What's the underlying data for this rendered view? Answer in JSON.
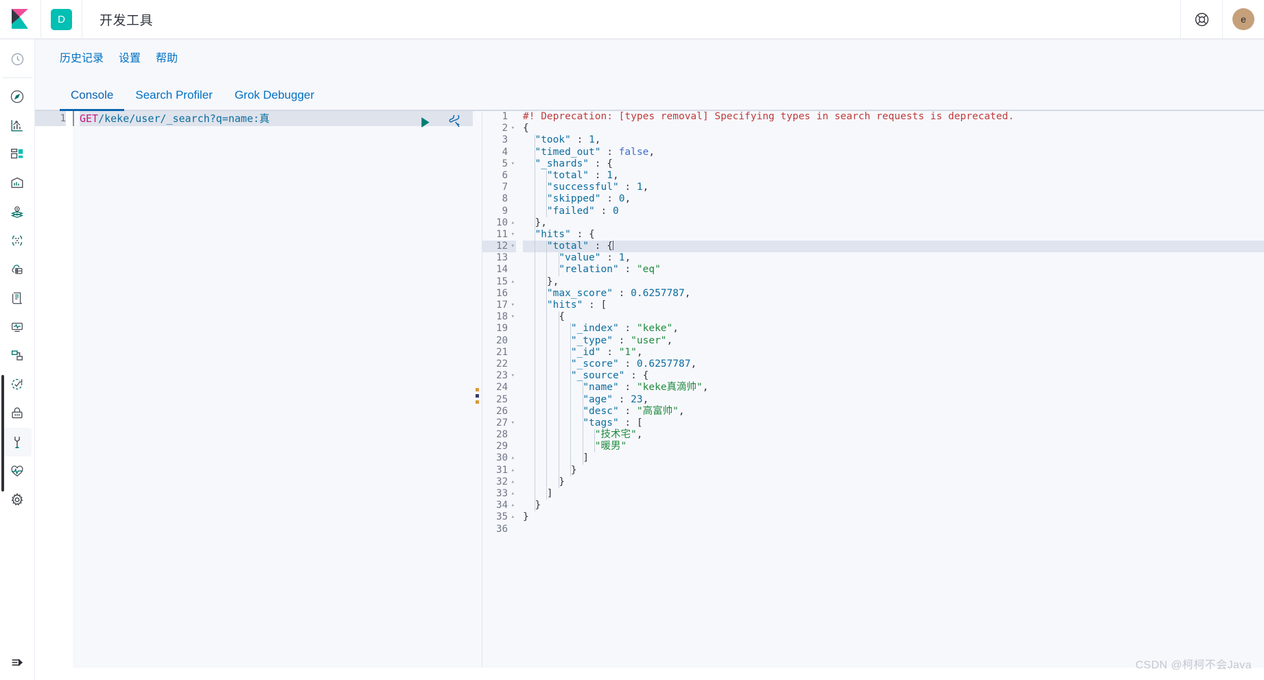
{
  "header": {
    "app_badge": "D",
    "title": "开发工具",
    "help_icon": "lifebuoy-icon",
    "avatar_initial": "e"
  },
  "sidebar": {
    "items": [
      {
        "icon": "clock-icon",
        "name": "recently-viewed"
      },
      {
        "icon": "compass-icon",
        "name": "discover"
      },
      {
        "icon": "bar-chart-icon",
        "name": "visualize"
      },
      {
        "icon": "dashboard-icon",
        "name": "dashboard"
      },
      {
        "icon": "canvas-icon",
        "name": "canvas"
      },
      {
        "icon": "map-pin-layers-icon",
        "name": "maps"
      },
      {
        "icon": "machine-learning-icon",
        "name": "machine-learning"
      },
      {
        "icon": "infrastructure-icon",
        "name": "infrastructure"
      },
      {
        "icon": "logs-icon",
        "name": "logs"
      },
      {
        "icon": "apm-icon",
        "name": "apm"
      },
      {
        "icon": "uptime-icon",
        "name": "uptime"
      },
      {
        "icon": "siem-icon",
        "name": "siem"
      },
      {
        "icon": "lock-icon",
        "name": "security"
      },
      {
        "icon": "wrench-icon",
        "name": "dev-tools",
        "selected": true
      },
      {
        "icon": "heartbeat-icon",
        "name": "monitoring"
      },
      {
        "icon": "gear-icon",
        "name": "management"
      }
    ],
    "collapse_icon": "collapse-arrow-icon"
  },
  "topnav": {
    "links": [
      {
        "label": "历史记录"
      },
      {
        "label": "设置"
      },
      {
        "label": "帮助"
      }
    ]
  },
  "tabs": [
    {
      "label": "Console",
      "active": true
    },
    {
      "label": "Search Profiler",
      "active": false
    },
    {
      "label": "Grok Debugger",
      "active": false
    }
  ],
  "editor": {
    "line_number": "1",
    "method": "GET",
    "path": "/keke/user/_search?q=name:真",
    "run_icon": "play-icon",
    "wrench_icon": "wrench-icon"
  },
  "splitter": {
    "name": "pane-splitter",
    "grip_icon": "drag-handle-icon"
  },
  "response": {
    "lines": [
      {
        "n": "1",
        "fold": "",
        "indent": 0,
        "tokens": [
          {
            "t": "#! Deprecation: [types removal] Specifying types in search requests is deprecated.",
            "c": "tok-warn"
          }
        ]
      },
      {
        "n": "2",
        "fold": "▾",
        "indent": 0,
        "tokens": [
          {
            "t": "{",
            "c": "tok-pun"
          }
        ]
      },
      {
        "n": "3",
        "fold": "",
        "indent": 1,
        "tokens": [
          {
            "t": "\"took\"",
            "c": "tok-key"
          },
          {
            "t": " : ",
            "c": "tok-pun"
          },
          {
            "t": "1",
            "c": "tok-num"
          },
          {
            "t": ",",
            "c": "tok-pun"
          }
        ]
      },
      {
        "n": "4",
        "fold": "",
        "indent": 1,
        "tokens": [
          {
            "t": "\"timed_out\"",
            "c": "tok-key"
          },
          {
            "t": " : ",
            "c": "tok-pun"
          },
          {
            "t": "false",
            "c": "tok-bool"
          },
          {
            "t": ",",
            "c": "tok-pun"
          }
        ]
      },
      {
        "n": "5",
        "fold": "▾",
        "indent": 1,
        "tokens": [
          {
            "t": "\"_shards\"",
            "c": "tok-key"
          },
          {
            "t": " : {",
            "c": "tok-pun"
          }
        ]
      },
      {
        "n": "6",
        "fold": "",
        "indent": 2,
        "tokens": [
          {
            "t": "\"total\"",
            "c": "tok-key"
          },
          {
            "t": " : ",
            "c": "tok-pun"
          },
          {
            "t": "1",
            "c": "tok-num"
          },
          {
            "t": ",",
            "c": "tok-pun"
          }
        ]
      },
      {
        "n": "7",
        "fold": "",
        "indent": 2,
        "tokens": [
          {
            "t": "\"successful\"",
            "c": "tok-key"
          },
          {
            "t": " : ",
            "c": "tok-pun"
          },
          {
            "t": "1",
            "c": "tok-num"
          },
          {
            "t": ",",
            "c": "tok-pun"
          }
        ]
      },
      {
        "n": "8",
        "fold": "",
        "indent": 2,
        "tokens": [
          {
            "t": "\"skipped\"",
            "c": "tok-key"
          },
          {
            "t": " : ",
            "c": "tok-pun"
          },
          {
            "t": "0",
            "c": "tok-num"
          },
          {
            "t": ",",
            "c": "tok-pun"
          }
        ]
      },
      {
        "n": "9",
        "fold": "",
        "indent": 2,
        "tokens": [
          {
            "t": "\"failed\"",
            "c": "tok-key"
          },
          {
            "t": " : ",
            "c": "tok-pun"
          },
          {
            "t": "0",
            "c": "tok-num"
          }
        ]
      },
      {
        "n": "10",
        "fold": "▴",
        "indent": 1,
        "tokens": [
          {
            "t": "},",
            "c": "tok-pun"
          }
        ]
      },
      {
        "n": "11",
        "fold": "▾",
        "indent": 1,
        "tokens": [
          {
            "t": "\"hits\"",
            "c": "tok-key"
          },
          {
            "t": " : {",
            "c": "tok-pun"
          }
        ]
      },
      {
        "n": "12",
        "fold": "▾",
        "indent": 2,
        "highlight": true,
        "caret": true,
        "tokens": [
          {
            "t": "\"total\"",
            "c": "tok-key"
          },
          {
            "t": " : {",
            "c": "tok-pun"
          }
        ]
      },
      {
        "n": "13",
        "fold": "",
        "indent": 3,
        "tokens": [
          {
            "t": "\"value\"",
            "c": "tok-key"
          },
          {
            "t": " : ",
            "c": "tok-pun"
          },
          {
            "t": "1",
            "c": "tok-num"
          },
          {
            "t": ",",
            "c": "tok-pun"
          }
        ]
      },
      {
        "n": "14",
        "fold": "",
        "indent": 3,
        "tokens": [
          {
            "t": "\"relation\"",
            "c": "tok-key"
          },
          {
            "t": " : ",
            "c": "tok-pun"
          },
          {
            "t": "\"eq\"",
            "c": "tok-str"
          }
        ]
      },
      {
        "n": "15",
        "fold": "▴",
        "indent": 2,
        "tokens": [
          {
            "t": "},",
            "c": "tok-pun"
          }
        ]
      },
      {
        "n": "16",
        "fold": "",
        "indent": 2,
        "tokens": [
          {
            "t": "\"max_score\"",
            "c": "tok-key"
          },
          {
            "t": " : ",
            "c": "tok-pun"
          },
          {
            "t": "0.6257787",
            "c": "tok-num"
          },
          {
            "t": ",",
            "c": "tok-pun"
          }
        ]
      },
      {
        "n": "17",
        "fold": "▾",
        "indent": 2,
        "tokens": [
          {
            "t": "\"hits\"",
            "c": "tok-key"
          },
          {
            "t": " : [",
            "c": "tok-pun"
          }
        ]
      },
      {
        "n": "18",
        "fold": "▾",
        "indent": 3,
        "tokens": [
          {
            "t": "{",
            "c": "tok-pun"
          }
        ]
      },
      {
        "n": "19",
        "fold": "",
        "indent": 4,
        "tokens": [
          {
            "t": "\"_index\"",
            "c": "tok-key"
          },
          {
            "t": " : ",
            "c": "tok-pun"
          },
          {
            "t": "\"keke\"",
            "c": "tok-str"
          },
          {
            "t": ",",
            "c": "tok-pun"
          }
        ]
      },
      {
        "n": "20",
        "fold": "",
        "indent": 4,
        "tokens": [
          {
            "t": "\"_type\"",
            "c": "tok-key"
          },
          {
            "t": " : ",
            "c": "tok-pun"
          },
          {
            "t": "\"user\"",
            "c": "tok-str"
          },
          {
            "t": ",",
            "c": "tok-pun"
          }
        ]
      },
      {
        "n": "21",
        "fold": "",
        "indent": 4,
        "tokens": [
          {
            "t": "\"_id\"",
            "c": "tok-key"
          },
          {
            "t": " : ",
            "c": "tok-pun"
          },
          {
            "t": "\"1\"",
            "c": "tok-str"
          },
          {
            "t": ",",
            "c": "tok-pun"
          }
        ]
      },
      {
        "n": "22",
        "fold": "",
        "indent": 4,
        "tokens": [
          {
            "t": "\"_score\"",
            "c": "tok-key"
          },
          {
            "t": " : ",
            "c": "tok-pun"
          },
          {
            "t": "0.6257787",
            "c": "tok-num"
          },
          {
            "t": ",",
            "c": "tok-pun"
          }
        ]
      },
      {
        "n": "23",
        "fold": "▾",
        "indent": 4,
        "tokens": [
          {
            "t": "\"_source\"",
            "c": "tok-key"
          },
          {
            "t": " : {",
            "c": "tok-pun"
          }
        ]
      },
      {
        "n": "24",
        "fold": "",
        "indent": 5,
        "tokens": [
          {
            "t": "\"name\"",
            "c": "tok-key"
          },
          {
            "t": " : ",
            "c": "tok-pun"
          },
          {
            "t": "\"keke真滴帅\"",
            "c": "tok-str"
          },
          {
            "t": ",",
            "c": "tok-pun"
          }
        ]
      },
      {
        "n": "25",
        "fold": "",
        "indent": 5,
        "tokens": [
          {
            "t": "\"age\"",
            "c": "tok-key"
          },
          {
            "t": " : ",
            "c": "tok-pun"
          },
          {
            "t": "23",
            "c": "tok-num"
          },
          {
            "t": ",",
            "c": "tok-pun"
          }
        ]
      },
      {
        "n": "26",
        "fold": "",
        "indent": 5,
        "tokens": [
          {
            "t": "\"desc\"",
            "c": "tok-key"
          },
          {
            "t": " : ",
            "c": "tok-pun"
          },
          {
            "t": "\"高富帅\"",
            "c": "tok-str"
          },
          {
            "t": ",",
            "c": "tok-pun"
          }
        ]
      },
      {
        "n": "27",
        "fold": "▾",
        "indent": 5,
        "tokens": [
          {
            "t": "\"tags\"",
            "c": "tok-key"
          },
          {
            "t": " : [",
            "c": "tok-pun"
          }
        ]
      },
      {
        "n": "28",
        "fold": "",
        "indent": 6,
        "tokens": [
          {
            "t": "\"技术宅\"",
            "c": "tok-str"
          },
          {
            "t": ",",
            "c": "tok-pun"
          }
        ]
      },
      {
        "n": "29",
        "fold": "",
        "indent": 6,
        "tokens": [
          {
            "t": "\"暖男\"",
            "c": "tok-str"
          }
        ]
      },
      {
        "n": "30",
        "fold": "▴",
        "indent": 5,
        "tokens": [
          {
            "t": "]",
            "c": "tok-pun"
          }
        ]
      },
      {
        "n": "31",
        "fold": "▴",
        "indent": 4,
        "tokens": [
          {
            "t": "}",
            "c": "tok-pun"
          }
        ]
      },
      {
        "n": "32",
        "fold": "▴",
        "indent": 3,
        "tokens": [
          {
            "t": "}",
            "c": "tok-pun"
          }
        ]
      },
      {
        "n": "33",
        "fold": "▴",
        "indent": 2,
        "tokens": [
          {
            "t": "]",
            "c": "tok-pun"
          }
        ]
      },
      {
        "n": "34",
        "fold": "▴",
        "indent": 1,
        "tokens": [
          {
            "t": "}",
            "c": "tok-pun"
          }
        ]
      },
      {
        "n": "35",
        "fold": "▴",
        "indent": 0,
        "tokens": [
          {
            "t": "}",
            "c": "tok-pun"
          }
        ]
      },
      {
        "n": "36",
        "fold": "",
        "indent": 0,
        "tokens": []
      }
    ]
  },
  "watermark": "CSDN @柯柯不会Java",
  "colors": {
    "accent_blue": "#0071c2",
    "active_tab": "#0b64ad",
    "badge_teal": "#00BFB3",
    "kibana_pink": "#F04E98",
    "play_green": "#017d73",
    "avatar_tan": "#c5a07a",
    "string_green": "#1f8a3e",
    "warn_red": "#bd3c3c",
    "method_magenta": "#c4187f"
  }
}
